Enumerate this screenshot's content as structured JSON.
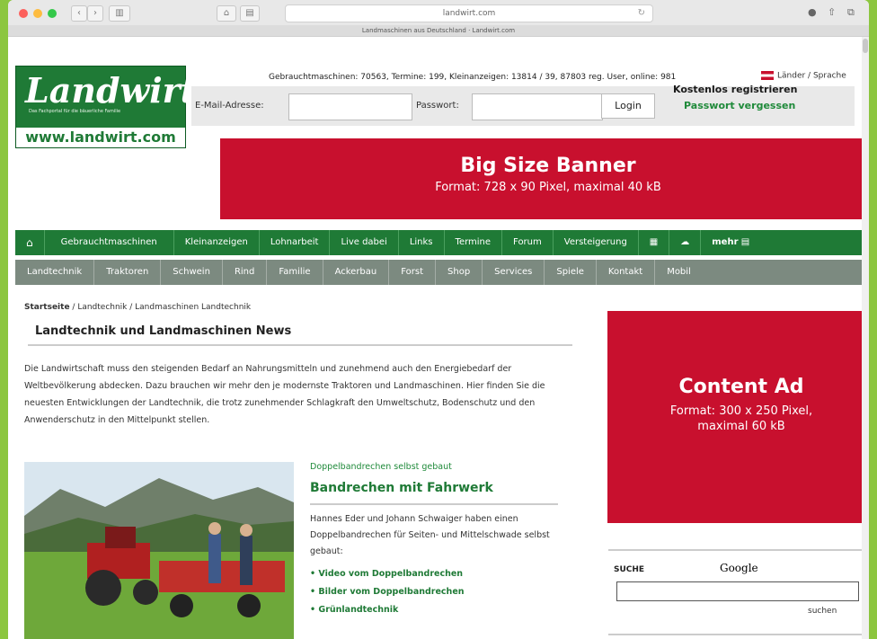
{
  "browser": {
    "url": "landwirt.com",
    "tab_title": "Landmaschinen aus Deutschland · Landwirt.com",
    "back": "‹",
    "forward": "›"
  },
  "logo": {
    "name": "Landwirt",
    "tagline": "Das Fachportal für die bäuerliche Familie",
    "site": "www.landwirt.com"
  },
  "stats": {
    "text_prefix": "Gebrauchtmaschinen: 70563, Termine: 199, Kleinanzeigen: 13814 / 39, 87803 reg. User, online: 981",
    "lang": "Länder / Sprache"
  },
  "login": {
    "email_label": "E-Mail-Adresse:",
    "password_label": "Passwort:",
    "login_button": "Login",
    "register": "Kostenlos registrieren",
    "forgot": "Passwort vergessen"
  },
  "banner": {
    "title": "Big Size Banner",
    "subtitle": "Format: 728 x 90 Pixel, maximal 40 kB"
  },
  "main_nav": [
    "Gebrauchtmaschinen",
    "Kleinanzeigen",
    "Lohnarbeit",
    "Live dabei",
    "Links",
    "Termine",
    "Forum",
    "Versteigerung"
  ],
  "main_nav_more": "mehr",
  "sub_nav": [
    "Landtechnik",
    "Traktoren",
    "Schwein",
    "Rind",
    "Familie",
    "Ackerbau",
    "Forst",
    "Shop",
    "Services",
    "Spiele",
    "Kontakt",
    "Mobil"
  ],
  "breadcrumb": {
    "home": "Startseite",
    "rest": " / Landtechnik / Landmaschinen Landtechnik"
  },
  "heading": "Landtechnik und Landmaschinen News",
  "lead": "Die Landwirtschaft muss den steigenden Bedarf an Nahrungsmitteln und zunehmend auch den Energiebedarf der Weltbevölkerung abdecken. Dazu brauchen wir mehr den je modernste Traktoren und Landmaschinen. Hier finden Sie die neuesten Entwicklungen der Landtechnik, die trotz zunehmender Schlagkraft den Umweltschutz, Bodenschutz und den Anwenderschutz in den Mittelpunkt stellen.",
  "feature": {
    "kicker": "Doppelbandrechen selbst gebaut",
    "title": "Bandrechen mit Fahrwerk",
    "text": "Hannes Eder und Johann Schwaiger haben einen Doppelbandrechen für Seiten- und Mittelschwade selbst gebaut:",
    "links": [
      "Video vom Doppelbandrechen",
      "Bilder vom Doppelbandrechen",
      "Grünlandtechnik"
    ]
  },
  "content_ad": {
    "title": "Content Ad",
    "subtitle": "Format: 300 x 250 Pixel, maximal 60 kB"
  },
  "search": {
    "label": "SUCHE",
    "provider": "Google",
    "button": "suchen"
  },
  "colors": {
    "brand_green": "#1f7a36",
    "ad_red": "#c8102e",
    "subnav_grey": "#7c8a80",
    "background_green": "#8cc63f"
  }
}
